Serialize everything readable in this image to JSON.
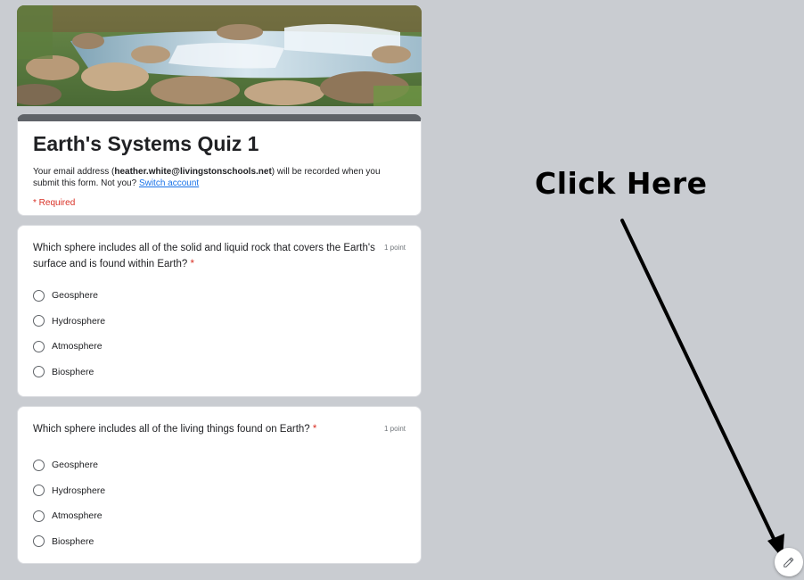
{
  "form": {
    "title": "Earth's Systems Quiz 1",
    "email_note_prefix": "Your email address (",
    "email": "heather.white@livingstonschools.net",
    "email_note_suffix": ") will be recorded when you submit this form. Not you?",
    "switch_account_label": "Switch account",
    "required_note": "* Required",
    "header_bar_color": "#5f6368"
  },
  "questions": [
    {
      "text": "Which sphere includes all of the solid and liquid rock that covers the Earth's surface and is found within Earth?",
      "required_mark": "*",
      "points": "1 point",
      "options": [
        "Geosphere",
        "Hydrosphere",
        "Atmosphere",
        "Biosphere"
      ]
    },
    {
      "text": "Which sphere includes all of the living things found on Earth?",
      "required_mark": "*",
      "points": "1 point",
      "options": [
        "Geosphere",
        "Hydrosphere",
        "Atmosphere",
        "Biosphere"
      ]
    }
  ],
  "annotation": {
    "text": "Click Here"
  },
  "edit_button": {
    "icon": "pencil-icon"
  }
}
